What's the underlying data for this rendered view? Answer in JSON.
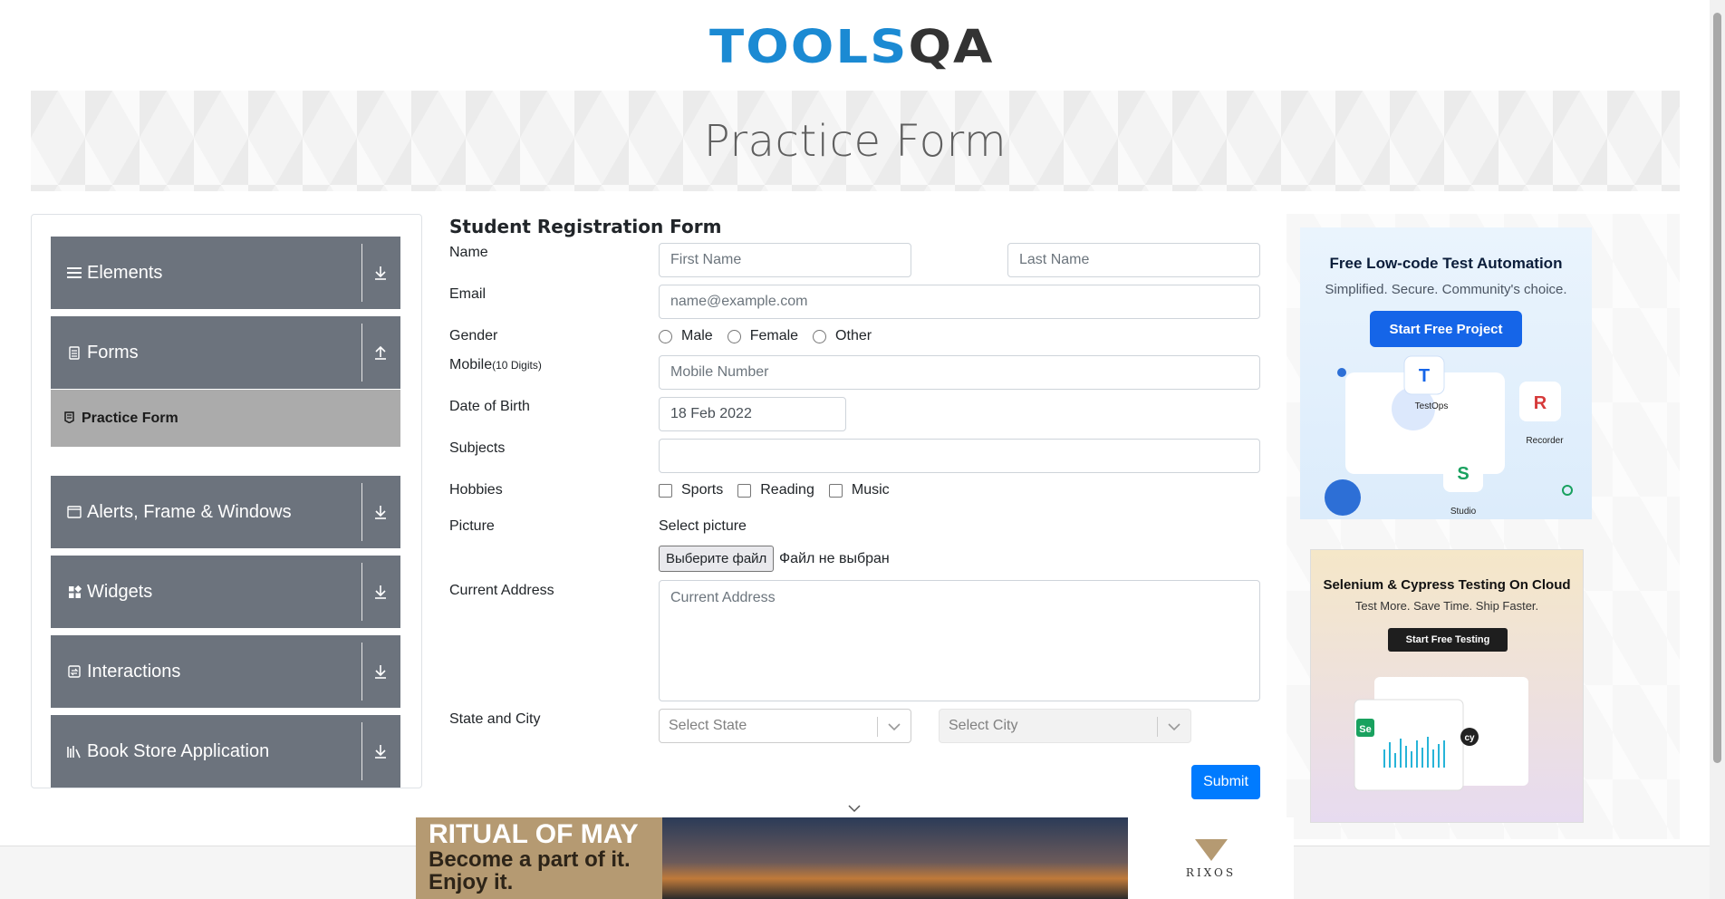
{
  "logo": {
    "tools": "TOOLS",
    "qa": "QA"
  },
  "banner": {
    "title": "Practice Form"
  },
  "sidebar": {
    "groups": [
      {
        "label": "Elements",
        "icon": "hamburger-icon"
      },
      {
        "label": "Forms",
        "icon": "document-icon"
      },
      {
        "label": "Alerts, Frame & Windows",
        "icon": "window-icon"
      },
      {
        "label": "Widgets",
        "icon": "widgets-icon"
      },
      {
        "label": "Interactions",
        "icon": "interactions-icon"
      },
      {
        "label": "Book Store Application",
        "icon": "books-icon"
      }
    ],
    "active_item": "Practice Form"
  },
  "form": {
    "title": "Student Registration Form",
    "name_label": "Name",
    "first_name_placeholder": "First Name",
    "last_name_placeholder": "Last Name",
    "email_label": "Email",
    "email_placeholder": "name@example.com",
    "gender_label": "Gender",
    "genders": [
      "Male",
      "Female",
      "Other"
    ],
    "mobile_label": "Mobile",
    "mobile_hint": "(10 Digits)",
    "mobile_placeholder": "Mobile Number",
    "dob_label": "Date of Birth",
    "dob_value": "18 Feb 2022",
    "subjects_label": "Subjects",
    "hobbies_label": "Hobbies",
    "hobbies": [
      "Sports",
      "Reading",
      "Music"
    ],
    "picture_label": "Picture",
    "picture_prompt": "Select picture",
    "file_button": "Выберите файл",
    "file_status": "Файл не выбран",
    "address_label": "Current Address",
    "address_placeholder": "Current Address",
    "state_city_label": "State and City",
    "state_placeholder": "Select State",
    "city_placeholder": "Select City",
    "submit": "Submit"
  },
  "ads": {
    "ad1": {
      "heading": "Free Low-code Test Automation",
      "sub": "Simplified. Secure. Community's choice.",
      "button": "Start Free Project",
      "labels": [
        "TestOps",
        "Recorder",
        "Studio"
      ]
    },
    "ad2": {
      "heading": "Selenium & Cypress Testing On Cloud",
      "sub": "Test More. Save Time. Ship Faster.",
      "button": "Start Free Testing"
    },
    "bottom": {
      "line1": "RITUAL OF MAY",
      "line2": "Become a part of it.",
      "line3": "Enjoy it.",
      "brand": "RIXOS"
    }
  },
  "colors": {
    "accent": "#007bff",
    "sidebar": "#6c737d",
    "active": "#ababab",
    "logo_blue": "#1b8ad3"
  }
}
